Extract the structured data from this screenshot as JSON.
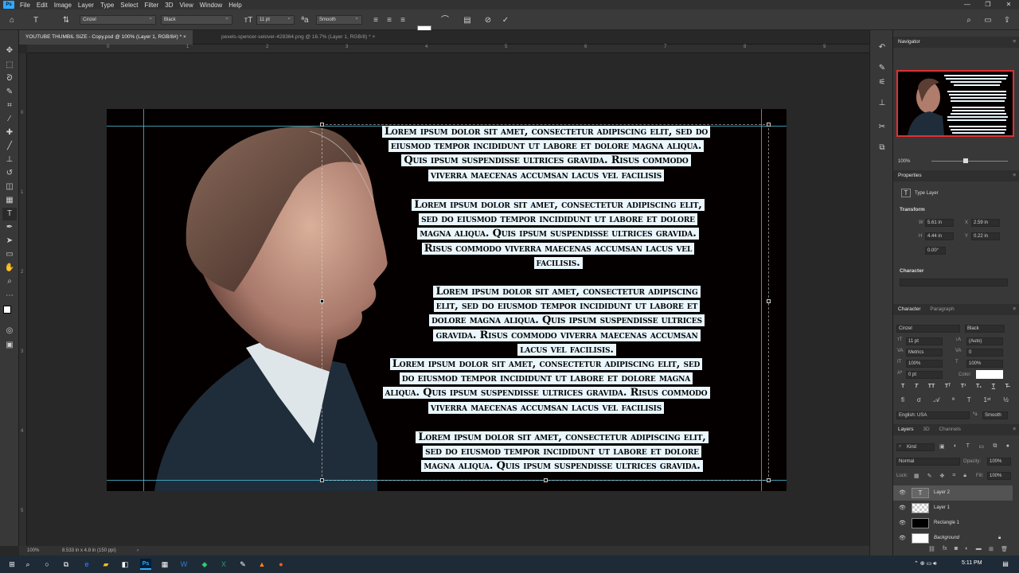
{
  "app": {
    "logo": "Ps"
  },
  "menu": [
    "File",
    "Edit",
    "Image",
    "Layer",
    "Type",
    "Select",
    "Filter",
    "3D",
    "View",
    "Window",
    "Help"
  ],
  "window_controls": {
    "minimize": "—",
    "restore": "❐",
    "close": "✕"
  },
  "options": {
    "font_family": "Cinzel",
    "font_style": "Black",
    "font_size": "11 pt",
    "antialias": "Smooth"
  },
  "tabs": [
    {
      "label": "YOUTUBE THUMBIL SIZE - Copy.psd @ 100% (Layer 1, RGB/8#) *",
      "close": "×"
    },
    {
      "label": "pexels-spencer-selover-428364.png @ 16.7% (Layer 1, RGB/8) *",
      "close": "×"
    }
  ],
  "ruler_h": [
    "0",
    "1",
    "2",
    "3",
    "4",
    "5",
    "6",
    "7",
    "8",
    "9"
  ],
  "ruler_v": [
    "0",
    "1",
    "2",
    "3",
    "4",
    "5"
  ],
  "paragraphs": [
    [
      "Lorem ipsum dolor sit amet, consectetur adipiscing elit, sed do",
      "eiusmod tempor incididunt ut labore et dolore magna aliqua.",
      "Quis ipsum suspendisse ultrices gravida. Risus commodo",
      "viverra maecenas accumsan lacus vel facilisis"
    ],
    [
      "Lorem ipsum dolor sit amet, consectetur adipiscing elit,",
      "sed do eiusmod tempor incididunt ut labore et dolore",
      "magna aliqua. Quis ipsum suspendisse ultrices gravida.",
      "Risus commodo viverra maecenas accumsan lacus vel",
      "facilisis."
    ],
    [
      "Lorem ipsum dolor sit amet, consectetur adipiscing",
      "elit, sed do eiusmod tempor incididunt ut labore et",
      "dolore magna aliqua. Quis ipsum suspendisse ultrices",
      "gravida. Risus commodo viverra maecenas accumsan",
      "lacus vel facilisis."
    ],
    [
      "Lorem ipsum dolor sit amet, consectetur adipiscing elit, sed",
      "do eiusmod tempor incididunt ut labore et dolore magna",
      "aliqua. Quis ipsum suspendisse ultrices gravida. Risus commodo",
      "viverra maecenas accumsan lacus vel facilisis"
    ],
    [
      "Lorem ipsum dolor sit amet, consectetur adipiscing elit,",
      "sed do eiusmod tempor incididunt ut labore et dolore",
      "magna aliqua. Quis ipsum suspendisse ultrices gravida."
    ]
  ],
  "status": {
    "zoom": "100%",
    "doc_size": "8.533 in x 4.8 in (150 ppi)"
  },
  "navigator": {
    "title": "Navigator",
    "zoom": "100%"
  },
  "properties": {
    "title": "Properties",
    "kind": "Type Layer",
    "transform": "Transform",
    "w_label": "W",
    "w_value": "5.61 in",
    "h_label": "H",
    "h_value": "4.44 in",
    "x_label": "X",
    "x_value": "2.59 in",
    "y_label": "Y",
    "y_value": "0.22 in",
    "angle": "0.00°",
    "character_section": "Character"
  },
  "character": {
    "tab1": "Character",
    "tab2": "Paragraph",
    "font": "Cinzel",
    "style": "Black",
    "size": "11 pt",
    "leading": "(Auto)",
    "kerning": "Metrics",
    "tracking": "0",
    "vscale": "100%",
    "hscale": "100%",
    "baseline": "0 pt",
    "color_label": "Color:",
    "language": "English: USA",
    "antialias": "Smooth",
    "type_styles": [
      "T",
      "T",
      "TT",
      "Tᵀ",
      "T¹",
      "T₁",
      "T",
      "T̶"
    ]
  },
  "layers": {
    "tabs": [
      "Layers",
      "3D",
      "Channels"
    ],
    "filter": "Kind",
    "blend": "Normal",
    "opacity_label": "Opacity:",
    "opacity": "100%",
    "lock_label": "Lock:",
    "fill_label": "Fill:",
    "fill": "100%",
    "items": [
      "Layer 2",
      "Layer 1",
      "Rectangle 1",
      "Background"
    ]
  },
  "taskbar": {
    "time": "5:11 PM"
  },
  "colors": {
    "guide": "#4dc9e6",
    "highlight": "#eaf7ff",
    "accent": "#31a8ff"
  }
}
